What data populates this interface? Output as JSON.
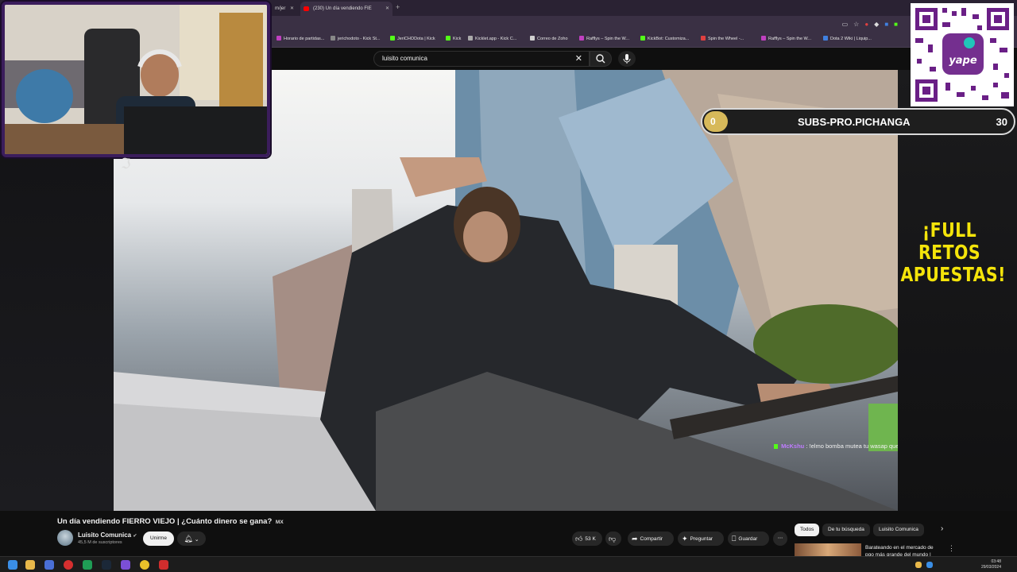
{
  "browser": {
    "tabs": [
      {
        "label": "m/jer",
        "active": false
      },
      {
        "label": "(230) Un día vendiendo FIE",
        "active": true
      }
    ],
    "bookmarks": [
      {
        "label": "Horario de partidas...",
        "color": "#c040c0"
      },
      {
        "label": "jerichodoto - Kick St...",
        "color": "#888888"
      },
      {
        "label": "JeriCHODota | Kick",
        "color": "#53fc18"
      },
      {
        "label": "Kick",
        "color": "#53fc18"
      },
      {
        "label": "Kicklet.app - Kick C...",
        "color": "#aaaaaa"
      },
      {
        "label": "Correo de Zoho",
        "color": "#d0d0d0"
      },
      {
        "label": "Rafflys – Spin the W...",
        "color": "#c040c0"
      },
      {
        "label": "KickBot: Customiza...",
        "color": "#53fc18"
      },
      {
        "label": "Spin the Wheel -...",
        "color": "#e04040"
      },
      {
        "label": "Rafflys – Spin the W...",
        "color": "#c040c0"
      },
      {
        "label": "Dota 2 Wiki | Liquip...",
        "color": "#4080e0"
      }
    ]
  },
  "search": {
    "query": "luisito comunica"
  },
  "overlay": {
    "goal": {
      "current": "0",
      "label": "SUBS-PRO.PICHANGA",
      "target": "30",
      "progress": 0
    },
    "promo_text": "¡FULL RETOS APUESTAS!",
    "qr_brand": "yape",
    "chat": {
      "user": "McKshu",
      "message": ": !elmo bomba mutea tu wasap que pienso que es mi ex"
    }
  },
  "video": {
    "title": "Un día vendiendo FIERRO VIEJO | ¿Cuánto dinero se gana?",
    "title_badge": "MX",
    "channel": "Luisito Comunica",
    "subscribers": "45,5 M de suscriptores",
    "join_label": "Unirme",
    "likes": "53 K",
    "share_label": "Compartir",
    "ask_label": "Preguntar",
    "save_label": "Guardar"
  },
  "recommendations": {
    "chips": [
      "Todos",
      "De tu búsqueda",
      "Luisito Comunica"
    ],
    "selected_chip": "Todos",
    "first_title": "Barateando en el mercado de pgo más grande del mundo |"
  },
  "taskbar": {
    "time": "03:48",
    "date": "29/03/2024"
  },
  "colors": {
    "accent_kick": "#53fc18",
    "webcam_frame": "#3b1d5c",
    "promo_yellow": "#f4e40a",
    "goal_fill": "#d7b95a"
  }
}
